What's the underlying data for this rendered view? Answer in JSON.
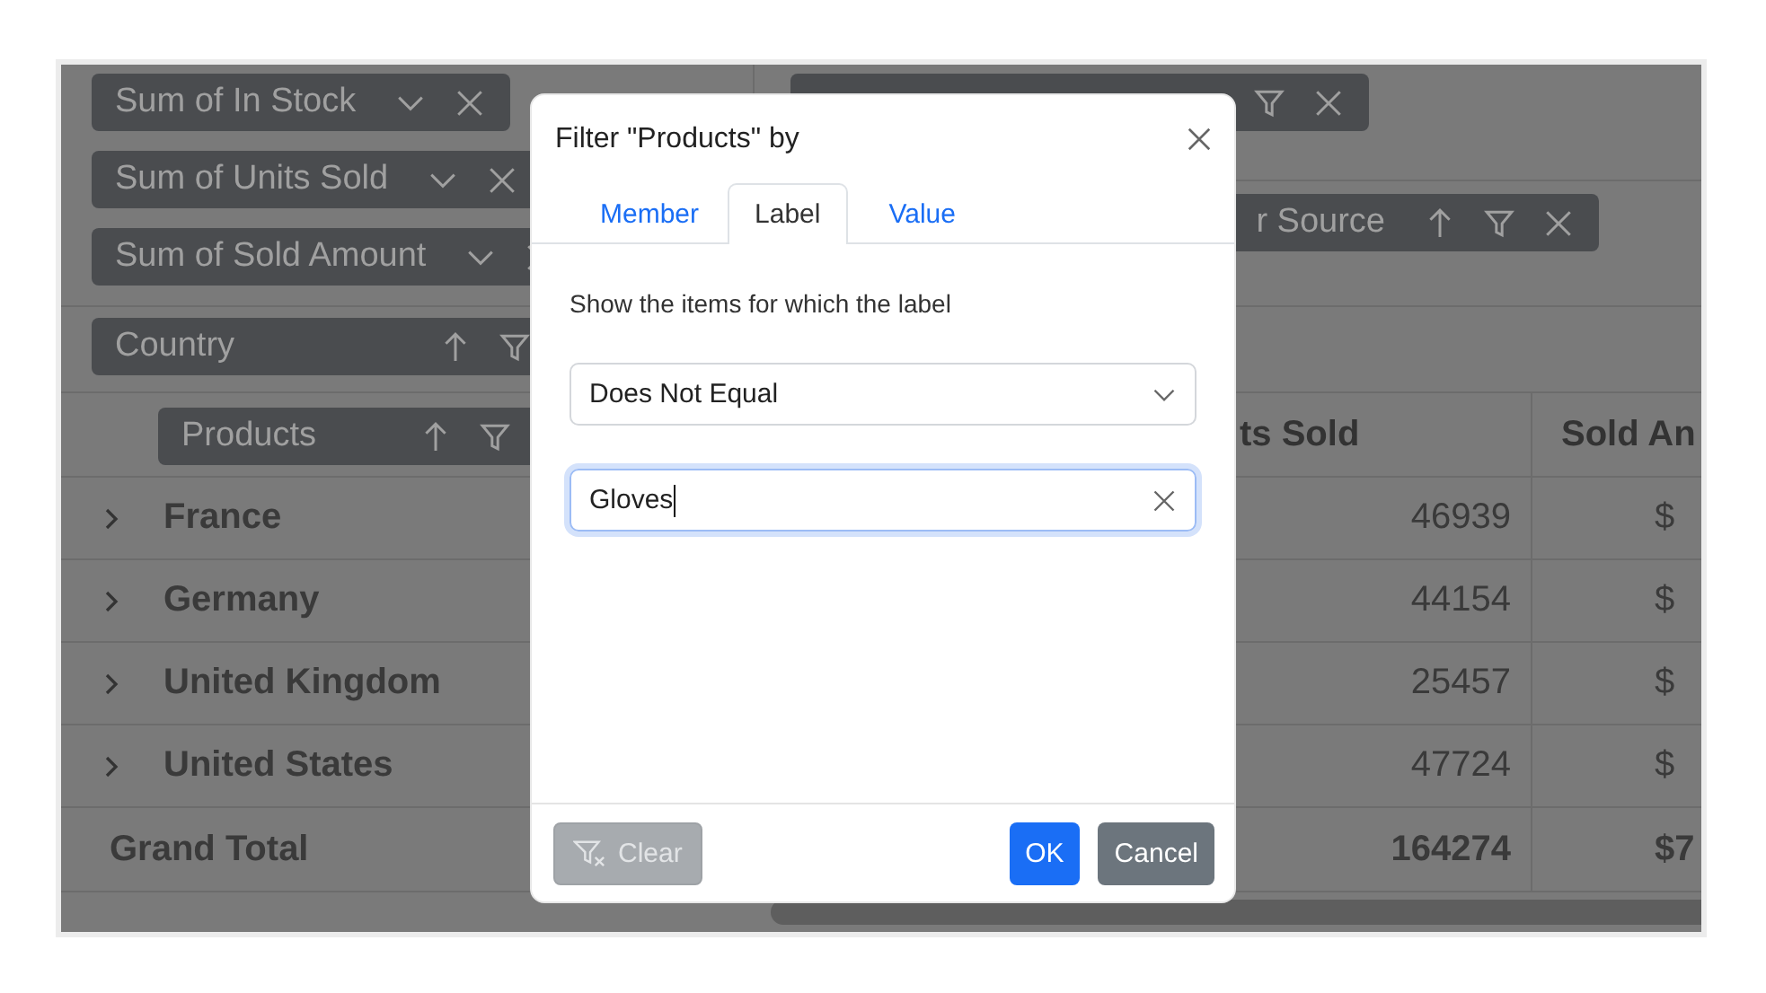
{
  "pivot": {
    "value_fields": [
      {
        "label": "Sum of In Stock"
      },
      {
        "label": "Sum of Units Sold"
      },
      {
        "label": "Sum of Sold Amount"
      }
    ],
    "filter_fields": [
      {
        "label": "r Source"
      }
    ],
    "row_fields": [
      {
        "label": "Country"
      },
      {
        "label": "Products"
      }
    ],
    "table": {
      "columns": [
        {
          "label": "ts Sold"
        },
        {
          "label": "Sold An"
        }
      ],
      "rows": [
        {
          "kind": "group",
          "expanded": false,
          "label": "France",
          "column_3": "46939",
          "column_4": "$"
        },
        {
          "kind": "group",
          "expanded": false,
          "label": "Germany",
          "column_3": "44154",
          "column_4": "$"
        },
        {
          "kind": "group",
          "expanded": false,
          "label": "United Kingdom",
          "column_3": "25457",
          "column_4": "$"
        },
        {
          "kind": "group",
          "expanded": false,
          "label": "United States",
          "column_3": "47724",
          "column_4": "$"
        },
        {
          "kind": "total",
          "label": "Grand Total",
          "column_3": "164274",
          "column_4": "$7"
        }
      ]
    }
  },
  "dialog": {
    "title": "Filter \"Products\" by",
    "tabs": [
      {
        "label": "Member",
        "selected": false
      },
      {
        "label": "Label",
        "selected": true
      },
      {
        "label": "Value",
        "selected": false
      }
    ],
    "prompt": "Show the items for which the label",
    "condition": {
      "value": "Does Not Equal"
    },
    "input": {
      "value": "Gloves",
      "focused": true
    },
    "buttons": [
      {
        "label": "Clear",
        "kind": "clear",
        "disabled": true
      },
      {
        "label": "OK",
        "kind": "primary",
        "disabled": false
      },
      {
        "label": "Cancel",
        "kind": "secondary",
        "disabled": false
      }
    ]
  }
}
